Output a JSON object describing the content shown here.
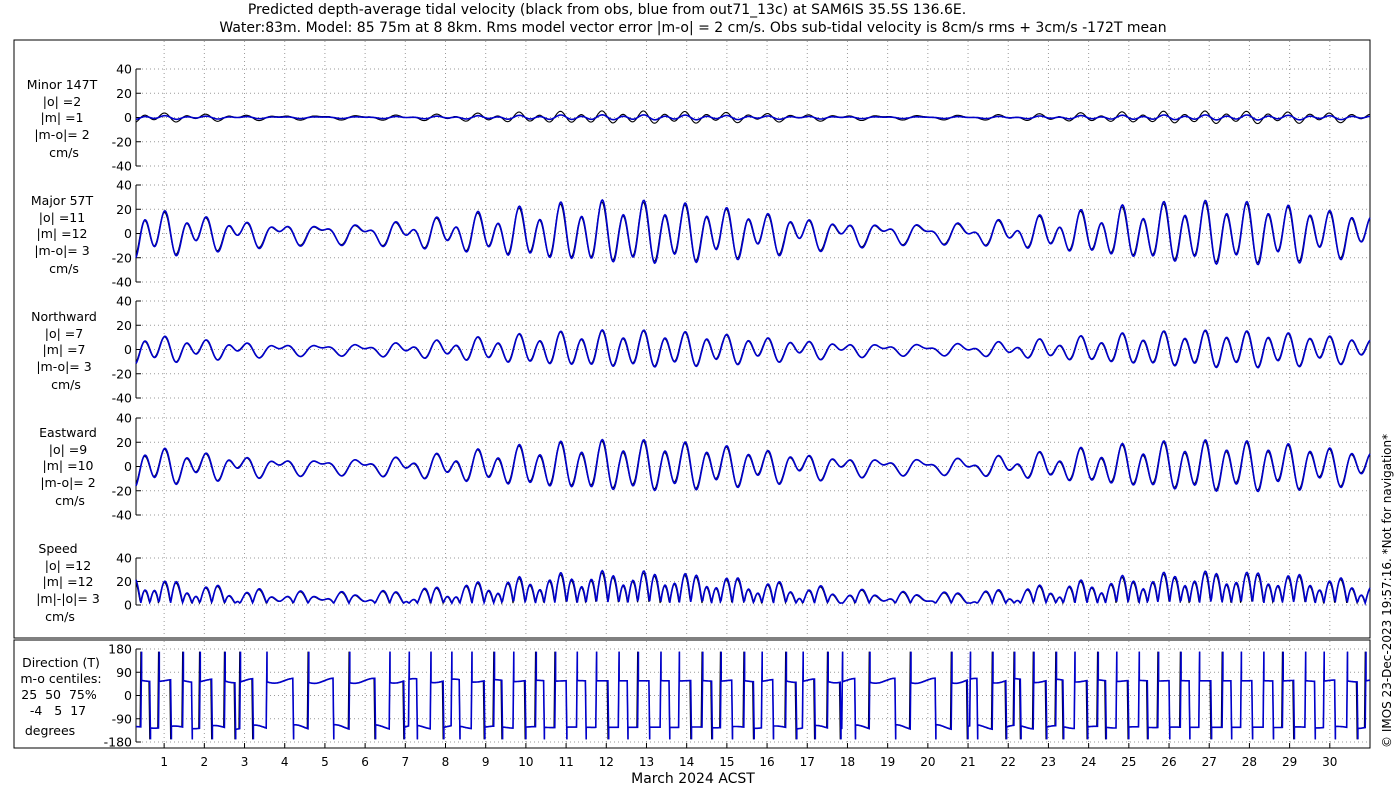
{
  "title": {
    "line1": "Predicted depth-average tidal velocity (black from obs, blue from out71_13c) at SAM6IS 35.5S 136.6E.",
    "line2": "Water:83m. Model: 85 75m at 8 8km. Rms model vector error |m-o| = 2 cm/s. Obs sub-tidal velocity is 8cm/s rms + 3cm/s -172T mean"
  },
  "side_note": "© IMOS 23-Dec-2023 19:57:16. *Not for navigation*",
  "colors": {
    "obs": "#000000",
    "model": "#0000cc",
    "grid": "#9a9a9a"
  },
  "chart_data": {
    "type": "line",
    "xlabel": "March 2024 ACST",
    "x_ticks": [
      "1",
      "2",
      "3",
      "4",
      "5",
      "6",
      "7",
      "8",
      "9",
      "10",
      "11",
      "12",
      "13",
      "14",
      "15",
      "16",
      "17",
      "18",
      "19",
      "20",
      "21",
      "22",
      "23",
      "24",
      "25",
      "26",
      "27",
      "28",
      "29",
      "30"
    ],
    "xlim_days": [
      0.3,
      31.0
    ],
    "grid": true,
    "series_legend": "black from obs, blue from out71_13c",
    "panels": [
      {
        "key": "minor",
        "label": [
          "Minor 147T",
          "|o| =2",
          "|m| =1",
          "|m-o|= 2",
          "cm/s"
        ],
        "ylim": [
          -40,
          40
        ],
        "yticks": [
          "40",
          "20",
          "0",
          "-20",
          "-40"
        ],
        "yticks_values": [
          40,
          20,
          0,
          -20,
          -40
        ],
        "obs": {
          "semidiurnal_amp_cm_s": 3.0,
          "diurnal_amp_cm_s": 1.5
        },
        "model": {
          "semidiurnal_amp_cm_s": 1.2,
          "diurnal_amp_cm_s": 0.6
        }
      },
      {
        "key": "major",
        "label": [
          "Major 57T",
          "|o| =11",
          "|m| =12",
          "|m-o|= 3",
          "cm/s"
        ],
        "ylim": [
          -40,
          40
        ],
        "yticks": [
          "40",
          "20",
          "0",
          "-20",
          "-40"
        ],
        "yticks_values": [
          40,
          20,
          0,
          -20,
          -40
        ],
        "obs": {
          "semidiurnal_amp_cm_s": 15.0,
          "diurnal_amp_cm_s": 6.0
        },
        "model": {
          "semidiurnal_amp_cm_s": 16.0,
          "diurnal_amp_cm_s": 6.5
        }
      },
      {
        "key": "north",
        "label": [
          "Northward",
          "|o| =7",
          "|m| =7",
          "|m-o|= 3",
          "cm/s"
        ],
        "ylim": [
          -40,
          40
        ],
        "yticks": [
          "40",
          "20",
          "0",
          "-20",
          "-40"
        ],
        "yticks_values": [
          40,
          20,
          0,
          -20,
          -40
        ],
        "obs": {
          "semidiurnal_amp_cm_s": 9.0,
          "diurnal_amp_cm_s": 3.5
        },
        "model": {
          "semidiurnal_amp_cm_s": 9.5,
          "diurnal_amp_cm_s": 3.5
        }
      },
      {
        "key": "east",
        "label": [
          "Eastward",
          "|o| =9",
          "|m| =10",
          "|m-o|= 2",
          "cm/s"
        ],
        "ylim": [
          -40,
          40
        ],
        "yticks": [
          "40",
          "20",
          "0",
          "-20",
          "-40"
        ],
        "yticks_values": [
          40,
          20,
          0,
          -20,
          -40
        ],
        "obs": {
          "semidiurnal_amp_cm_s": 12.0,
          "diurnal_amp_cm_s": 5.0
        },
        "model": {
          "semidiurnal_amp_cm_s": 13.0,
          "diurnal_amp_cm_s": 5.0
        }
      },
      {
        "key": "speed",
        "label": [
          "Speed",
          "|o| =12",
          "|m| =12",
          "|m|-|o|= 3",
          "cm/s"
        ],
        "ylim": [
          0,
          40
        ],
        "yticks": [
          "40",
          "20",
          "0"
        ],
        "yticks_values": [
          40,
          20,
          0
        ],
        "obs": {
          "semidiurnal_amp_cm_s": 15.0,
          "diurnal_amp_cm_s": 6.0
        },
        "model": {
          "semidiurnal_amp_cm_s": 16.0,
          "diurnal_amp_cm_s": 6.5
        }
      },
      {
        "key": "direction",
        "label": [
          "Direction (T)",
          "m-o centiles:",
          "25  50  75%",
          "-4   5  17",
          "degrees"
        ],
        "ylim": [
          -180,
          180
        ],
        "yticks": [
          "180",
          "90",
          "0",
          "-90",
          "-180"
        ],
        "yticks_values": [
          180,
          90,
          0,
          -90,
          -180
        ],
        "centiles": {
          "p25": -4,
          "p50": 5,
          "p75": 17
        },
        "flood_deg": 57,
        "ebb_deg": -123
      }
    ]
  }
}
